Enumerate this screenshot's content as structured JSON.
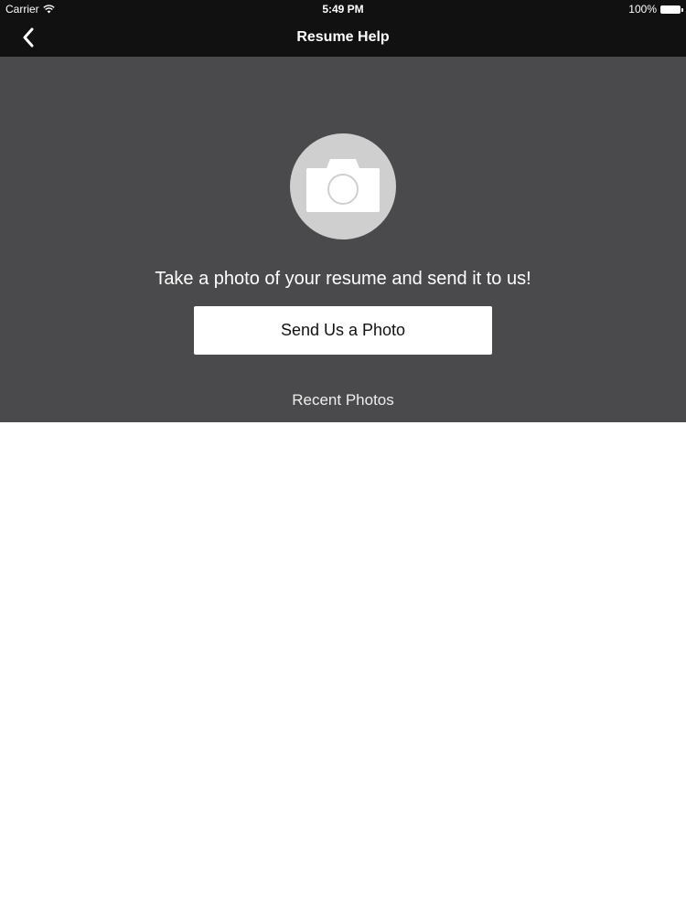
{
  "status_bar": {
    "carrier": "Carrier",
    "time": "5:49 PM",
    "battery": "100%"
  },
  "nav": {
    "title": "Resume Help",
    "back_icon": "chevron-left-icon"
  },
  "panel": {
    "icon": "camera-icon",
    "prompt": "Take a photo of your resume and send it to us!",
    "send_button_label": "Send Us a Photo",
    "recent_label": "Recent Photos"
  },
  "colors": {
    "bar_background": "#111111",
    "panel_background": "#4a494b",
    "icon_circle": "#cfcfcf",
    "button_background": "#ffffff"
  }
}
